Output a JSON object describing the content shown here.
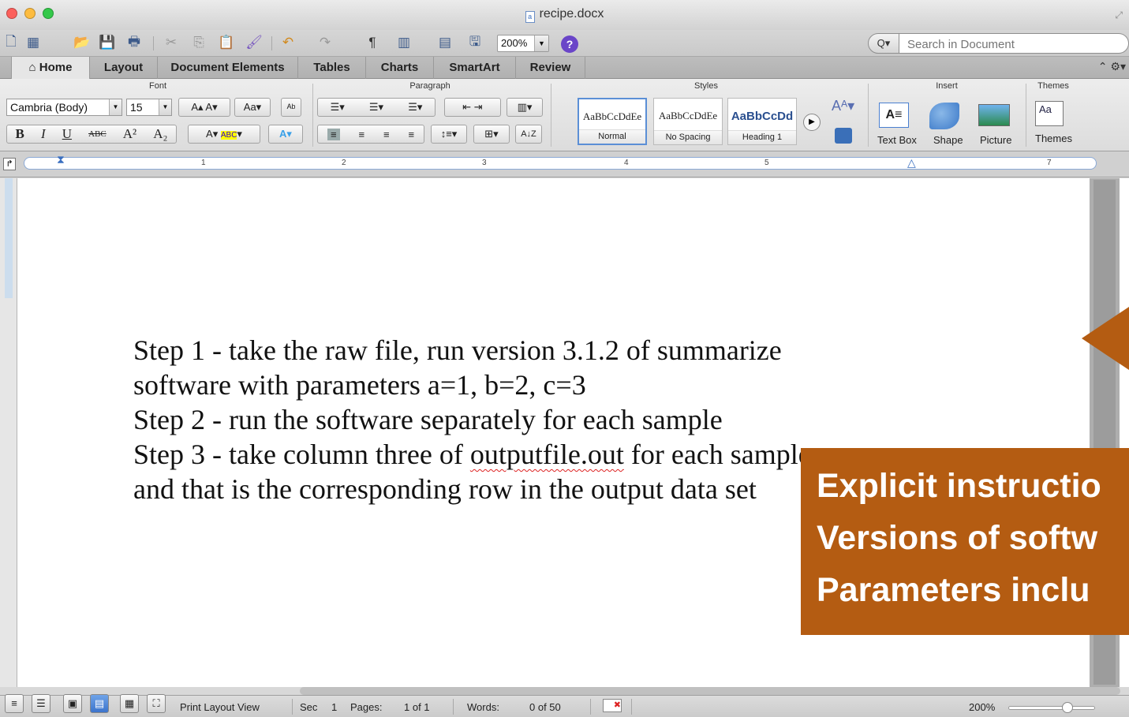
{
  "window": {
    "title": "recipe.docx"
  },
  "toolbar": {
    "zoom_value": "200%",
    "help_label": "?",
    "search_placeholder": "Search in Document"
  },
  "tabs": [
    {
      "label": "Home",
      "active": true
    },
    {
      "label": "Layout"
    },
    {
      "label": "Document Elements"
    },
    {
      "label": "Tables"
    },
    {
      "label": "Charts"
    },
    {
      "label": "SmartArt"
    },
    {
      "label": "Review"
    }
  ],
  "ribbon": {
    "groups": {
      "font": "Font",
      "paragraph": "Paragraph",
      "styles": "Styles",
      "insert": "Insert",
      "themes": "Themes"
    },
    "font_name": "Cambria (Body)",
    "font_size": "15",
    "styles": [
      {
        "sample": "AaBbCcDdEe",
        "label": "Normal"
      },
      {
        "sample": "AaBbCcDdEe",
        "label": "No Spacing"
      },
      {
        "sample": "AaBbCcDd",
        "label": "Heading 1"
      }
    ],
    "insert": {
      "text_box": "Text Box",
      "shape": "Shape",
      "picture": "Picture"
    },
    "themes_label": "Themes"
  },
  "ruler": {
    "marks": [
      "1",
      "2",
      "3",
      "4",
      "5",
      "7"
    ]
  },
  "document": {
    "lines": [
      "Step 1 - take the raw file, run version 3.1.2 of summarize",
      "software with parameters a=1, b=2, c=3",
      "Step 2 - run the software separately for each sample"
    ],
    "line4_before": "Step 3 - take column three of ",
    "line4_link": "outputfile.out",
    "line4_after": " for each sample",
    "line5": "and that is the corresponding row in the output data set"
  },
  "callout": {
    "color": "#b45c12",
    "lines": [
      "Explicit instructio",
      "Versions of softw",
      "Parameters inclu"
    ]
  },
  "status": {
    "view_name": "Print Layout View",
    "sec_label": "Sec",
    "sec_value": "1",
    "pages_label": "Pages:",
    "pages_value": "1 of 1",
    "words_label": "Words:",
    "words_value": "0 of 50",
    "zoom": "200%"
  }
}
